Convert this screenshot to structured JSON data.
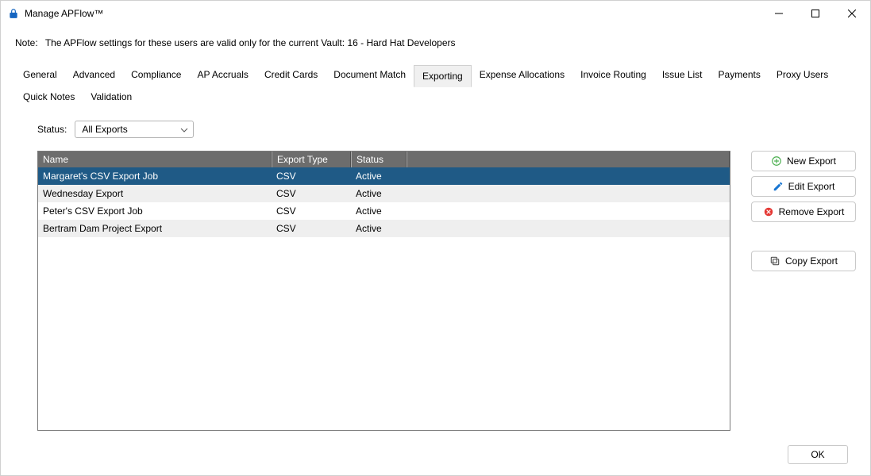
{
  "window": {
    "title": "Manage APFlow™"
  },
  "note": {
    "label": "Note:",
    "text": "The APFlow settings for these users are valid only for the current Vault: 16 - Hard Hat Developers"
  },
  "tabs": [
    "General",
    "Advanced",
    "Compliance",
    "AP Accruals",
    "Credit Cards",
    "Document Match",
    "Exporting",
    "Expense Allocations",
    "Invoice Routing",
    "Issue List",
    "Payments",
    "Proxy Users",
    "Quick Notes",
    "Validation"
  ],
  "active_tab_index": 6,
  "status": {
    "label": "Status:",
    "selected": "All Exports"
  },
  "columns": {
    "name": "Name",
    "export_type": "Export Type",
    "status": "Status"
  },
  "rows": [
    {
      "name": "Margaret's CSV Export Job",
      "type": "CSV",
      "status": "Active",
      "selected": true
    },
    {
      "name": "Wednesday Export",
      "type": "CSV",
      "status": "Active",
      "selected": false
    },
    {
      "name": "Peter's CSV Export Job",
      "type": "CSV",
      "status": "Active",
      "selected": false
    },
    {
      "name": "Bertram Dam Project Export",
      "type": "CSV",
      "status": "Active",
      "selected": false
    }
  ],
  "buttons": {
    "new": "New Export",
    "edit": "Edit Export",
    "remove": "Remove Export",
    "copy": "Copy Export",
    "ok": "OK"
  },
  "colors": {
    "selected_row": "#1f5a86",
    "header_bg": "#6d6d6d",
    "green": "#4caf50",
    "blue": "#1976d2",
    "red": "#e53935"
  }
}
